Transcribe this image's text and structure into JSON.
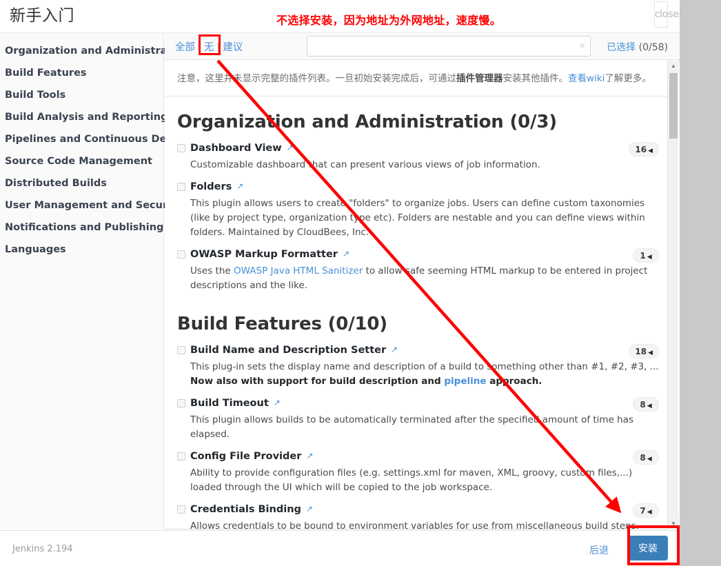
{
  "header": {
    "title": "新手入门",
    "close_icon": "close-icon"
  },
  "annotations": {
    "top_note": "不选择安装，因为地址为外网地址，速度慢。",
    "arrow_color": "#ff0000",
    "highlight_color": "#ff0000"
  },
  "sidebar": {
    "items": [
      {
        "label": "Organization and Administration"
      },
      {
        "label": "Build Features"
      },
      {
        "label": "Build Tools"
      },
      {
        "label": "Build Analysis and Reporting"
      },
      {
        "label": "Pipelines and Continuous Delivery"
      },
      {
        "label": "Source Code Management"
      },
      {
        "label": "Distributed Builds"
      },
      {
        "label": "User Management and Security"
      },
      {
        "label": "Notifications and Publishing"
      },
      {
        "label": "Languages"
      }
    ]
  },
  "toolbar": {
    "filter_all": "全部",
    "filter_none": "无",
    "filter_suggested": "建议",
    "separator": "|",
    "search_value": "",
    "search_placeholder": "",
    "clear_icon": "×",
    "selected_label": "已选择",
    "selected_count": "(0/58)"
  },
  "notice": {
    "part1": "注意，这里并未显示完整的插件列表。一旦初始安装完成后，可通过",
    "bold": "插件管理器",
    "part2": "安装其他插件。",
    "link": "查看wiki",
    "part3": "了解更多。"
  },
  "sections": [
    {
      "title": "Organization and Administration (0/3)",
      "plugins": [
        {
          "name": "Dashboard View",
          "badge": "16",
          "caret": "◀",
          "desc_html": "Customizable dashboard that can present various views of job information."
        },
        {
          "name": "Folders",
          "badge": "",
          "caret": "",
          "desc_html": "This plugin allows users to create \"folders\" to organize jobs. Users can define custom taxonomies (like by project type, organization type etc). Folders are nestable and you can define views within folders. Maintained by CloudBees, Inc."
        },
        {
          "name": "OWASP Markup Formatter",
          "badge": "1",
          "caret": "◀",
          "desc_html": "Uses the <a>OWASP Java HTML Sanitizer</a> to allow safe seeming HTML markup to be entered in project descriptions and the like."
        }
      ]
    },
    {
      "title": "Build Features (0/10)",
      "plugins": [
        {
          "name": "Build Name and Description Setter",
          "badge": "18",
          "caret": "◀",
          "desc_html": "This plug-in sets the display name and description of a build to something other than #1, #2, #3, ...<br><b>Now also with support for build description and <a>pipeline</a> approach.</b>"
        },
        {
          "name": "Build Timeout",
          "badge": "8",
          "caret": "◀",
          "desc_html": "This plugin allows builds to be automatically terminated after the specified amount of time has elapsed."
        },
        {
          "name": "Config File Provider",
          "badge": "8",
          "caret": "◀",
          "desc_html": "Ability to provide configuration files (e.g. settings.xml for maven, XML, groovy, custom files,...) loaded through the UI which will be copied to the job workspace."
        },
        {
          "name": "Credentials Binding",
          "badge": "7",
          "caret": "◀",
          "desc_html": "Allows credentials to be bound to environment variables for use from miscellaneous build steps."
        }
      ]
    }
  ],
  "scrollbar": {
    "up_arrow": "▲",
    "down_arrow": "▼"
  },
  "footer": {
    "version": "Jenkins 2.194",
    "back_label": "后退",
    "install_label": "安装"
  },
  "external_link_icon": "↗"
}
